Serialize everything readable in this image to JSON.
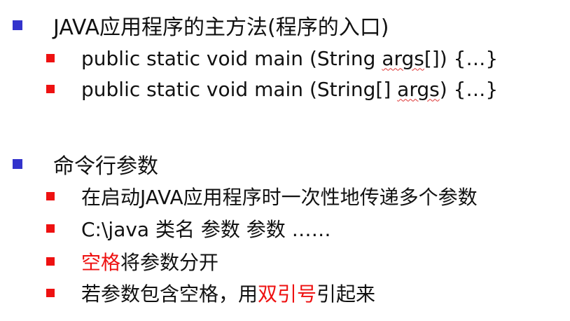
{
  "items": [
    {
      "text": "JAVA应用程序的主方法(程序的入口)",
      "children": [
        {
          "before": "public static void main (String ",
          "squiggle": "args",
          "after": "[]) {…}"
        },
        {
          "before": "public static void main (String[] ",
          "squiggle": "args",
          "after": ") {…}"
        }
      ]
    },
    {
      "text": "命令行参数",
      "children": [
        {
          "text": "在启动JAVA应用程序时一次性地传递多个参数"
        },
        {
          "text": "C:\\java 类名 参数 参数 ……"
        },
        {
          "red": "空格",
          "after": "将参数分开"
        },
        {
          "before": "若参数包含空格，用",
          "red": "双引号",
          "after": "引起来"
        }
      ]
    }
  ],
  "colors": {
    "level1_bullet": "#3333cc",
    "level2_bullet": "#ee1111",
    "highlight_text": "#ee1111",
    "spellcheck_underline": "#dd3333"
  }
}
